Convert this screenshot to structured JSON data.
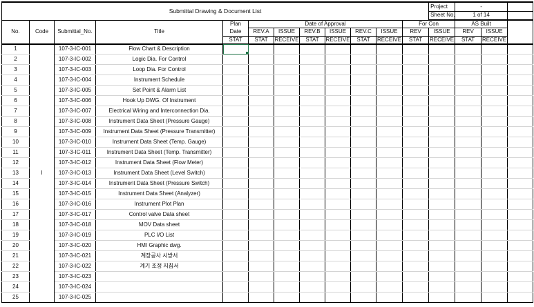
{
  "sheet": {
    "title": "Submittal Drawing & Document List",
    "project_label": "Project",
    "project_value": "-",
    "sheet_no_label": "Sheet No.",
    "sheet_no_value": "1 of 14"
  },
  "headers": {
    "no": "No.",
    "code": "Code",
    "submittal_no": "Submittal_No.",
    "title": "Title",
    "plan": "Plan",
    "date": "Date",
    "stat": "STAT",
    "date_of_approval": "Date of Approval",
    "rev_a": "REV.A",
    "issue": "ISSUE",
    "rev_b": "REV.B",
    "rev_c": "REV.C",
    "receive": "RECEIVE",
    "for_con": "For Con",
    "rev": "REV",
    "as_built": "AS Built"
  },
  "code_value": "I",
  "rows": [
    {
      "no": "1",
      "submittal": "107-3-IC-001",
      "title": "Flow Chart & Description"
    },
    {
      "no": "2",
      "submittal": "107-3-IC-002",
      "title": "Logic Dia. For Control"
    },
    {
      "no": "3",
      "submittal": "107-3-IC-003",
      "title": "Loop Dia. For Control"
    },
    {
      "no": "4",
      "submittal": "107-3-IC-004",
      "title": "Instrument Schedule"
    },
    {
      "no": "5",
      "submittal": "107-3-IC-005",
      "title": "Set Point & Alarm List"
    },
    {
      "no": "6",
      "submittal": "107-3-IC-006",
      "title": "Hook Up DWG. Of Instrument"
    },
    {
      "no": "7",
      "submittal": "107-3-IC-007",
      "title": "Electrical Wiring and Interconnection Dia."
    },
    {
      "no": "8",
      "submittal": "107-3-IC-008",
      "title": "Instrument Data Sheet (Pressure Gauge)"
    },
    {
      "no": "9",
      "submittal": "107-3-IC-009",
      "title": "Instrument Data Sheet (Pressure Transmitter)"
    },
    {
      "no": "10",
      "submittal": "107-3-IC-010",
      "title": "Instrument Data Sheet (Temp. Gauge)"
    },
    {
      "no": "11",
      "submittal": "107-3-IC-011",
      "title": "Instrument Data Sheet (Temp. Transmitter)"
    },
    {
      "no": "12",
      "submittal": "107-3-IC-012",
      "title": "Instrument Data Sheet (Flow Meter)"
    },
    {
      "no": "13",
      "submittal": "107-3-IC-013",
      "title": "Instrument Data Sheet (Level Switch)"
    },
    {
      "no": "14",
      "submittal": "107-3-IC-014",
      "title": "Instrument Data Sheet (Pressure Switch)"
    },
    {
      "no": "15",
      "submittal": "107-3-IC-015",
      "title": "Instrument Data Sheet (Analyzer)"
    },
    {
      "no": "16",
      "submittal": "107-3-IC-016",
      "title": "Instrument Plot Plan"
    },
    {
      "no": "17",
      "submittal": "107-3-IC-017",
      "title": "Control valve Data sheet"
    },
    {
      "no": "18",
      "submittal": "107-3-IC-018",
      "title": "MOV Data sheet"
    },
    {
      "no": "19",
      "submittal": "107-3-IC-019",
      "title": "PLC I/O List"
    },
    {
      "no": "20",
      "submittal": "107-3-IC-020",
      "title": "HMI Graphic dwg."
    },
    {
      "no": "21",
      "submittal": "107-3-IC-021",
      "title": "계장공사 시방서"
    },
    {
      "no": "22",
      "submittal": "107-3-IC-022",
      "title": "계기 조정 지침서"
    },
    {
      "no": "23",
      "submittal": "107-3-IC-023",
      "title": ""
    },
    {
      "no": "24",
      "submittal": "107-3-IC-024",
      "title": ""
    },
    {
      "no": "25",
      "submittal": "107-3-IC-025",
      "title": ""
    }
  ]
}
